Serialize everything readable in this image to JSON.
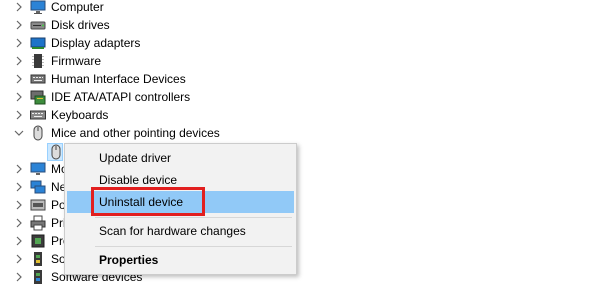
{
  "tree": {
    "items": [
      {
        "label": "Computer",
        "icon": "computer-icon",
        "expanded": false
      },
      {
        "label": "Disk drives",
        "icon": "disk-drive-icon",
        "expanded": false
      },
      {
        "label": "Display adapters",
        "icon": "display-adapter-icon",
        "expanded": false
      },
      {
        "label": "Firmware",
        "icon": "firmware-icon",
        "expanded": false
      },
      {
        "label": "Human Interface Devices",
        "icon": "hid-icon",
        "expanded": false
      },
      {
        "label": "IDE ATA/ATAPI controllers",
        "icon": "ide-controller-icon",
        "expanded": false
      },
      {
        "label": "Keyboards",
        "icon": "keyboard-icon",
        "expanded": false
      },
      {
        "label": "Mice and other pointing devices",
        "icon": "mouse-icon",
        "expanded": true
      },
      {
        "label": "Mo",
        "icon": "monitor-icon",
        "expanded": false
      },
      {
        "label": "Ne",
        "icon": "network-adapter-icon",
        "expanded": false
      },
      {
        "label": "Po",
        "icon": "port-icon",
        "expanded": false
      },
      {
        "label": "Pri",
        "icon": "print-queue-icon",
        "expanded": false
      },
      {
        "label": "Pro",
        "icon": "processor-icon",
        "expanded": false
      },
      {
        "label": "So",
        "icon": "software-component-icon",
        "expanded": false
      },
      {
        "label": "Software devices",
        "icon": "software-device-icon",
        "expanded": false
      }
    ]
  },
  "context_menu": {
    "items": {
      "update_driver": "Update driver",
      "disable_device": "Disable device",
      "uninstall_device": "Uninstall device",
      "scan_hardware": "Scan for hardware changes",
      "properties": "Properties"
    },
    "highlighted": "Uninstall device"
  },
  "colors": {
    "menu_bg": "#f2f2f2",
    "menu_highlight": "#91c9f7",
    "annotation_red": "#e21f1f",
    "selection": "#cce8ff"
  }
}
